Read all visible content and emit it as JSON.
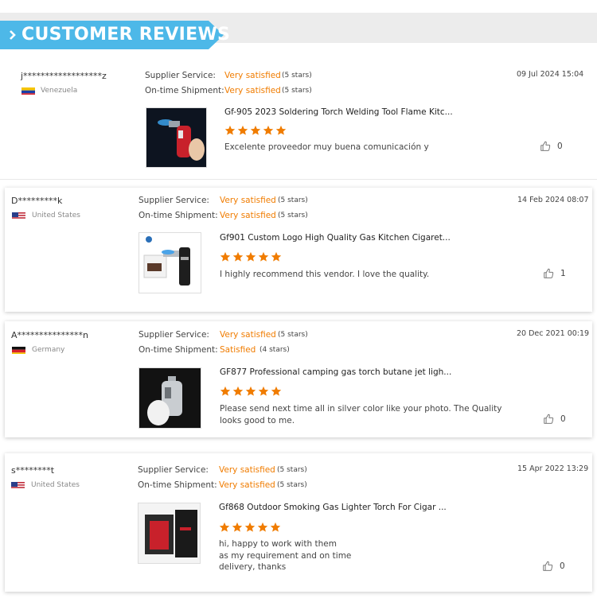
{
  "header": {
    "title": "CUSTOMER REVIEWS",
    "accent_color": "#4db8e8"
  },
  "colors": {
    "rating": "#f07c00",
    "star": "#f07c00"
  },
  "reviews": [
    {
      "buyer": "j******************z",
      "country": "Venezuela",
      "flag": "venezuela-flag",
      "supplier_label": "Supplier Service:",
      "supplier_rating": "Very satisfied",
      "supplier_stars": "(5 stars)",
      "shipment_label": "On-time Shipment:",
      "shipment_rating": "Very satisfied",
      "shipment_stars": "(5 stars)",
      "date": "09 Jul 2024 15:04",
      "product": "Gf-905 2023 Soldering Torch Welding Tool Flame Kitc...",
      "rating": 5,
      "comment": "Excelente proveedor muy buena comunicación y",
      "likes": "0"
    },
    {
      "buyer": "D*********k",
      "country": "United States",
      "flag": "usa-flag",
      "supplier_label": "Supplier Service:",
      "supplier_rating": "Very satisfied",
      "supplier_stars": "(5 stars)",
      "shipment_label": "On-time Shipment:",
      "shipment_rating": "Very satisfied",
      "shipment_stars": "(5 stars)",
      "date": "14 Feb 2024 08:07",
      "product": "Gf901 Custom Logo High Quality Gas Kitchen Cigaret...",
      "rating": 5,
      "comment": "I highly recommend this vendor.  I love the quality.",
      "likes": "1"
    },
    {
      "buyer": "A***************n",
      "country": "Germany",
      "flag": "germany-flag",
      "supplier_label": "Supplier Service:",
      "supplier_rating": "Very satisfied",
      "supplier_stars": "(5 stars)",
      "shipment_label": "On-time Shipment:",
      "shipment_rating": "Satisfied",
      "shipment_stars": "(4 stars)",
      "date": "20 Dec 2021 00:19",
      "product": "GF877 Professional camping gas torch butane jet ligh...",
      "rating": 5,
      "comment": "Please send next time all in silver color like your photo. The Quality looks good to me.",
      "likes": "0"
    },
    {
      "buyer": "s********t",
      "country": "United States",
      "flag": "usa-flag",
      "supplier_label": "Supplier Service:",
      "supplier_rating": "Very satisfied",
      "supplier_stars": "(5 stars)",
      "shipment_label": "On-time Shipment:",
      "shipment_rating": "Very satisfied",
      "shipment_stars": "(5 stars)",
      "date": "15 Apr 2022 13:29",
      "product": "Gf868 Outdoor Smoking Gas Lighter Torch For Cigar ...",
      "rating": 5,
      "comment_lines": [
        "hi, happy to work with them",
        "as my requirement and on time",
        "delivery, thanks"
      ],
      "likes": "0"
    }
  ]
}
